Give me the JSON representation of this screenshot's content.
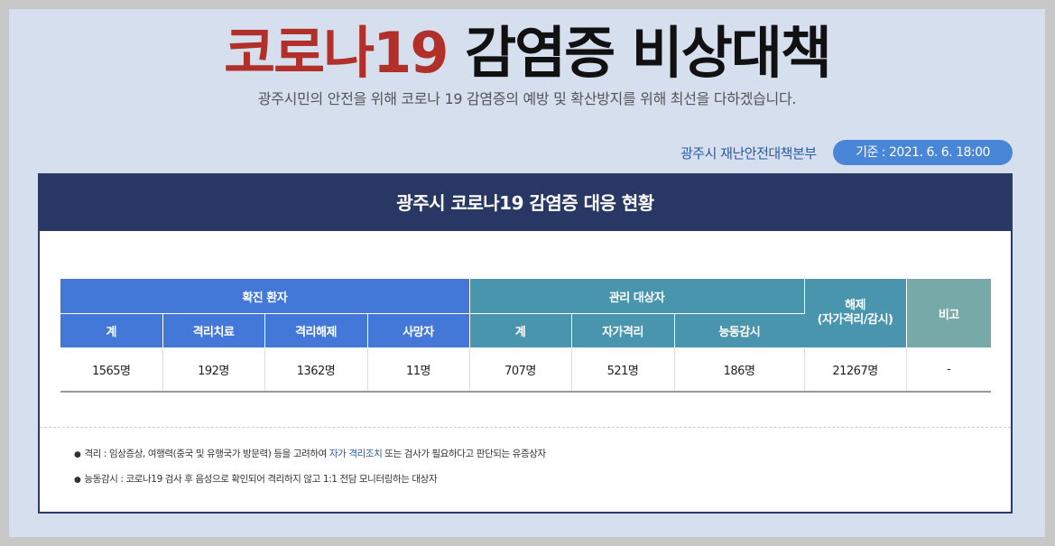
{
  "header": {
    "title_red": "코로나19",
    "title_black": "감염증 비상대책",
    "subtitle": "광주시민의 안전을 위해 코로나 19 감염증의 예방 및 확산방지를 위해 최선을 다하겠습니다.",
    "org": "광주시 재난안전대책본부",
    "date": "기준 : 2021. 6. 6. 18:00"
  },
  "panel": {
    "title": "광주시 코로나19 감염증 대응 현황"
  },
  "table": {
    "groups": {
      "confirmed": "확진 환자",
      "managed": "관리 대상자",
      "released": "해제\n(자가격리/감시)",
      "remarks": "비고"
    },
    "subheaders": {
      "total": "계",
      "isolation_treatment": "격리치료",
      "isolation_release": "격리해제",
      "deaths": "사망자",
      "managed_total": "계",
      "self_isolation": "자가격리",
      "active_monitoring": "능동감시"
    },
    "row": {
      "total": "1565명",
      "isolation_treatment": "192명",
      "isolation_release": "1362명",
      "deaths": "11명",
      "managed_total": "707명",
      "self_isolation": "521명",
      "active_monitoring": "186명",
      "released": "21267명",
      "remarks": "-"
    }
  },
  "notes": {
    "note1_pre": "격리 : 임상증상, 여행력(중국 및 유행국가 방문력) 등을 고려하여 ",
    "note1_hl": "자가 격리조치",
    "note1_post": " 또는 검사가 필요하다고 판단되는 유증상자",
    "note2": "능동감시 : 코로나19 검사 후 음성으로 확인되어 격리하지 않고 1:1 전담 모니터링하는 대상자"
  },
  "colors": {
    "title_red": "#b1302a",
    "panel_head": "#293764",
    "confirmed_header": "#4478d8",
    "managed_header": "#4a95ae",
    "remarks_header": "#78a9a9",
    "date_pill": "#4a86d8"
  }
}
